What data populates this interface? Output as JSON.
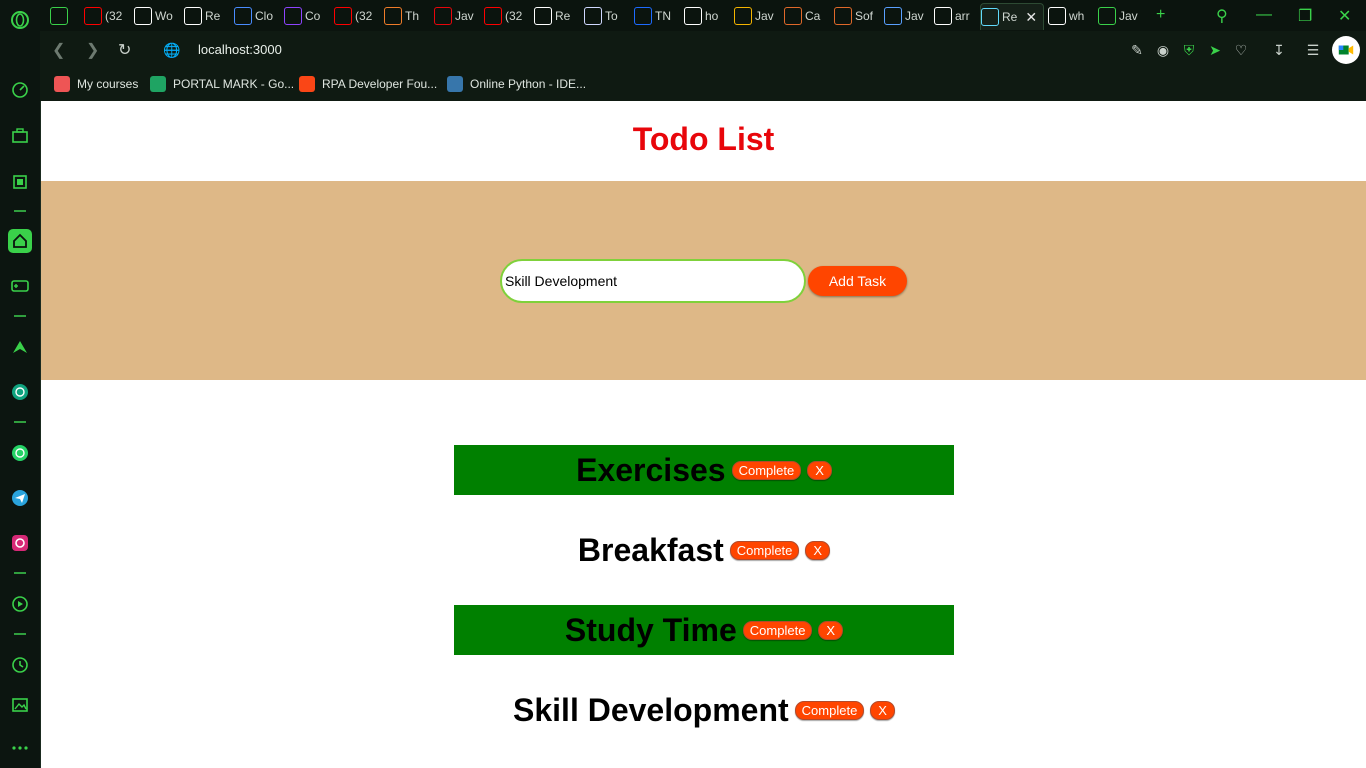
{
  "browser": {
    "tabs": [
      {
        "label": "",
        "icon": "gamepad-icon",
        "color": "#3ad14a"
      },
      {
        "label": "(32",
        "icon": "youtube-icon",
        "color": "#ff0000"
      },
      {
        "label": "Wo",
        "icon": "wordwall-icon",
        "color": "#ffffff"
      },
      {
        "label": "Re",
        "icon": "page-icon",
        "color": "#ffffff"
      },
      {
        "label": "Clo",
        "icon": "flag-icon",
        "color": "#4a8cff"
      },
      {
        "label": "Co",
        "icon": "u-icon",
        "color": "#8e44ff"
      },
      {
        "label": "(32",
        "icon": "youtube-icon",
        "color": "#ff0000"
      },
      {
        "label": "Th",
        "icon": "bf-icon",
        "color": "#f07c2a"
      },
      {
        "label": "Jav",
        "icon": "oracle-icon",
        "color": "#e8060b"
      },
      {
        "label": "(32",
        "icon": "youtube-icon",
        "color": "#ff0000"
      },
      {
        "label": "Re",
        "icon": "github-icon",
        "color": "#ffffff"
      },
      {
        "label": "To",
        "icon": "globe-icon",
        "color": "#d0d8ff"
      },
      {
        "label": "TN",
        "icon": "p-icon",
        "color": "#1e6bff"
      },
      {
        "label": "ho",
        "icon": "google-icon",
        "color": "#ffffff"
      },
      {
        "label": "Jav",
        "icon": "code-icon",
        "color": "#f5b400"
      },
      {
        "label": "Ca",
        "icon": "hexagon-icon",
        "color": "#e0692a"
      },
      {
        "label": "Sof",
        "icon": "hexagon-icon",
        "color": "#e0692a"
      },
      {
        "label": "Jav",
        "icon": "ib-icon",
        "color": "#5aa0ff"
      },
      {
        "label": "arr",
        "icon": "google-icon",
        "color": "#ffffff"
      },
      {
        "label": "Re",
        "icon": "react-icon",
        "color": "#61dafb"
      },
      {
        "label": "wh",
        "icon": "google-icon",
        "color": "#ffffff"
      },
      {
        "label": "Jav",
        "icon": "infinity-icon",
        "color": "#3ad14a"
      }
    ],
    "url": "localhost:3000",
    "bookmarks": [
      {
        "label": "My courses",
        "icon": "courses-icon",
        "color": "#e55"
      },
      {
        "label": "PORTAL MARK - Go...",
        "icon": "sheets-icon",
        "color": "#1fa463"
      },
      {
        "label": "RPA Developer Fou...",
        "icon": "uipath-icon",
        "color": "#fa4616"
      },
      {
        "label": "Online Python - IDE...",
        "icon": "python-shield-icon",
        "color": "#3776ab"
      }
    ]
  },
  "app": {
    "title": "Todo List",
    "input_value": "Skill Development",
    "add_label": "Add Task",
    "todos": [
      {
        "text": "Exercises",
        "completed": true
      },
      {
        "text": "Breakfast",
        "completed": false
      },
      {
        "text": "Study Time",
        "completed": true
      },
      {
        "text": "Skill Development",
        "completed": false
      }
    ],
    "complete_label": "Complete",
    "delete_label": "X"
  },
  "colors": {
    "title": "#e8060b",
    "band": "#deb887",
    "completed_bg": "#008000",
    "button": "#ff4500",
    "browser_accent": "#3ad14a"
  }
}
